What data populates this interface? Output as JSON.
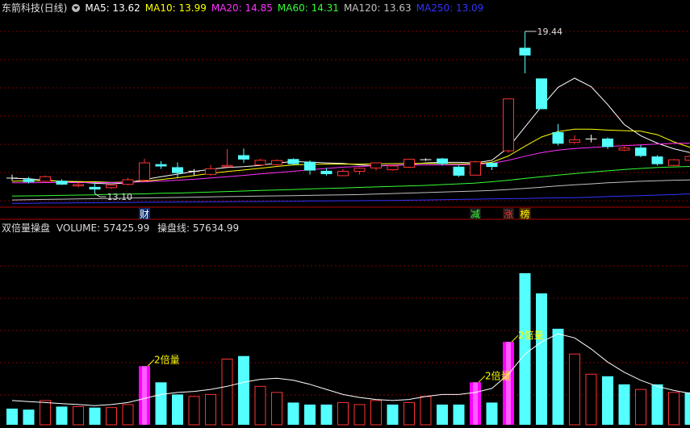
{
  "price_panel": {
    "stock_title": "东箭科技(日线)",
    "ma_items": [
      {
        "label": "MA5: 13.62",
        "color": "#ffffff"
      },
      {
        "label": "MA10: 13.99",
        "color": "#ffff00"
      },
      {
        "label": "MA20: 14.85",
        "color": "#ff33ff"
      },
      {
        "label": "MA60: 14.31",
        "color": "#33ff33"
      },
      {
        "label": "MA120: 13.63",
        "color": "#c0c0c0"
      },
      {
        "label": "MA250: 13.09",
        "color": "#3333ff"
      }
    ]
  },
  "volume_panel": {
    "indicator_name": "双倍量操盘",
    "volume_label": "VOLUME: 57425.99",
    "line_label": "操盘线: 57634.99"
  },
  "colors": {
    "up": "#ff3333",
    "down": "#54ffff",
    "double_volume": "#ff00ff",
    "grid": "#7a0000",
    "annotation": "#ffff00"
  },
  "chart_data": {
    "type": "candlestick",
    "ylim": [
      12.6,
      20.1
    ],
    "candles": [
      {
        "o": 13.72,
        "h": 13.84,
        "l": 13.6,
        "c": 13.72,
        "dir": "flat"
      },
      {
        "o": 13.66,
        "h": 13.75,
        "l": 13.5,
        "c": 13.55,
        "dir": "down"
      },
      {
        "o": 13.58,
        "h": 13.8,
        "l": 13.55,
        "c": 13.76,
        "dir": "up"
      },
      {
        "o": 13.6,
        "h": 13.66,
        "l": 13.44,
        "c": 13.45,
        "dir": "down"
      },
      {
        "o": 13.4,
        "h": 13.52,
        "l": 13.34,
        "c": 13.45,
        "dir": "up"
      },
      {
        "o": 13.36,
        "h": 13.52,
        "l": 13.1,
        "c": 13.26,
        "dir": "down"
      },
      {
        "o": 13.33,
        "h": 13.48,
        "l": 13.28,
        "c": 13.43,
        "dir": "up"
      },
      {
        "o": 13.46,
        "h": 13.72,
        "l": 13.42,
        "c": 13.64,
        "dir": "up"
      },
      {
        "o": 13.62,
        "h": 14.46,
        "l": 13.6,
        "c": 14.3,
        "dir": "up"
      },
      {
        "o": 14.25,
        "h": 14.37,
        "l": 14.06,
        "c": 14.16,
        "dir": "down"
      },
      {
        "o": 14.13,
        "h": 14.32,
        "l": 13.73,
        "c": 13.9,
        "dir": "down"
      },
      {
        "o": 13.96,
        "h": 14.06,
        "l": 13.8,
        "c": 13.99,
        "dir": "flat"
      },
      {
        "o": 13.85,
        "h": 14.22,
        "l": 13.8,
        "c": 14.07,
        "dir": "up"
      },
      {
        "o": 14.15,
        "h": 14.84,
        "l": 14.13,
        "c": 14.2,
        "dir": "up"
      },
      {
        "o": 14.6,
        "h": 14.86,
        "l": 14.3,
        "c": 14.43,
        "dir": "down"
      },
      {
        "o": 14.22,
        "h": 14.46,
        "l": 14.2,
        "c": 14.4,
        "dir": "up"
      },
      {
        "o": 14.23,
        "h": 14.44,
        "l": 14.19,
        "c": 14.39,
        "dir": "up"
      },
      {
        "o": 14.45,
        "h": 14.48,
        "l": 14.2,
        "c": 14.25,
        "dir": "down"
      },
      {
        "o": 14.34,
        "h": 14.4,
        "l": 13.84,
        "c": 14.0,
        "dir": "down"
      },
      {
        "o": 13.99,
        "h": 14.1,
        "l": 13.8,
        "c": 13.86,
        "dir": "down"
      },
      {
        "o": 13.8,
        "h": 14.05,
        "l": 13.78,
        "c": 13.97,
        "dir": "up"
      },
      {
        "o": 13.97,
        "h": 14.12,
        "l": 13.84,
        "c": 14.09,
        "dir": "up"
      },
      {
        "o": 14.1,
        "h": 14.3,
        "l": 14.0,
        "c": 14.3,
        "dir": "up"
      },
      {
        "o": 14.03,
        "h": 14.2,
        "l": 14.0,
        "c": 14.18,
        "dir": "up"
      },
      {
        "o": 14.13,
        "h": 14.46,
        "l": 14.1,
        "c": 14.44,
        "dir": "up"
      },
      {
        "o": 14.44,
        "h": 14.48,
        "l": 14.38,
        "c": 14.44,
        "dir": "flat"
      },
      {
        "o": 14.47,
        "h": 14.5,
        "l": 14.2,
        "c": 14.26,
        "dir": "down"
      },
      {
        "o": 14.15,
        "h": 14.2,
        "l": 13.75,
        "c": 13.8,
        "dir": "down"
      },
      {
        "o": 13.82,
        "h": 14.38,
        "l": 13.82,
        "c": 14.34,
        "dir": "up"
      },
      {
        "o": 14.3,
        "h": 14.35,
        "l": 14.02,
        "c": 14.14,
        "dir": "down"
      },
      {
        "o": 14.77,
        "h": 16.8,
        "l": 14.7,
        "c": 16.8,
        "dir": "up"
      },
      {
        "o": 18.8,
        "h": 19.44,
        "l": 17.8,
        "c": 18.5,
        "dir": "down"
      },
      {
        "o": 17.6,
        "h": 17.6,
        "l": 16.4,
        "c": 16.4,
        "dir": "down"
      },
      {
        "o": 15.5,
        "h": 15.82,
        "l": 14.98,
        "c": 15.05,
        "dir": "down"
      },
      {
        "o": 15.1,
        "h": 15.38,
        "l": 15.05,
        "c": 15.2,
        "dir": "up"
      },
      {
        "o": 15.25,
        "h": 15.4,
        "l": 15.1,
        "c": 15.25,
        "dir": "flat"
      },
      {
        "o": 15.25,
        "h": 15.3,
        "l": 14.84,
        "c": 14.92,
        "dir": "down"
      },
      {
        "o": 14.8,
        "h": 14.96,
        "l": 14.76,
        "c": 14.88,
        "dir": "up"
      },
      {
        "o": 14.9,
        "h": 15.0,
        "l": 14.52,
        "c": 14.57,
        "dir": "down"
      },
      {
        "o": 14.55,
        "h": 14.6,
        "l": 14.2,
        "c": 14.25,
        "dir": "down"
      },
      {
        "o": 14.2,
        "h": 14.45,
        "l": 14.18,
        "c": 14.42,
        "dir": "up"
      },
      {
        "o": 14.4,
        "h": 14.58,
        "l": 14.36,
        "c": 14.55,
        "dir": "up"
      }
    ],
    "ma_lines": {
      "ma5": [
        13.7,
        13.68,
        13.62,
        13.58,
        13.55,
        13.5,
        13.48,
        13.52,
        13.65,
        13.76,
        13.86,
        13.96,
        14.05,
        14.12,
        14.15,
        14.2,
        14.3,
        14.35,
        14.33,
        14.3,
        14.28,
        14.22,
        14.18,
        14.2,
        14.24,
        14.3,
        14.32,
        14.32,
        14.3,
        14.4,
        14.9,
        15.7,
        16.5,
        17.25,
        17.61,
        17.28,
        16.58,
        15.8,
        15.36,
        15.07,
        14.85,
        14.7
      ],
      "ma10": [
        13.58,
        13.6,
        13.6,
        13.58,
        13.57,
        13.56,
        13.54,
        13.55,
        13.58,
        13.65,
        13.72,
        13.8,
        13.89,
        13.96,
        14.02,
        14.09,
        14.16,
        14.22,
        14.24,
        14.25,
        14.25,
        14.25,
        14.26,
        14.27,
        14.28,
        14.28,
        14.27,
        14.26,
        14.26,
        14.32,
        14.57,
        14.95,
        15.31,
        15.52,
        15.62,
        15.62,
        15.58,
        15.56,
        15.54,
        15.4,
        15.12,
        14.9
      ],
      "ma20": [
        13.52,
        13.52,
        13.53,
        13.53,
        13.53,
        13.53,
        13.53,
        13.54,
        13.56,
        13.59,
        13.62,
        13.66,
        13.71,
        13.76,
        13.81,
        13.87,
        13.92,
        13.97,
        14.03,
        14.08,
        14.13,
        14.16,
        14.19,
        14.21,
        14.22,
        14.22,
        14.22,
        14.22,
        14.24,
        14.28,
        14.4,
        14.56,
        14.7,
        14.8,
        14.86,
        14.9,
        14.94,
        14.97,
        15.0,
        15.04,
        15.06,
        15.07
      ],
      "ma60": [
        13.0,
        13.01,
        13.02,
        13.03,
        13.04,
        13.05,
        13.07,
        13.08,
        13.09,
        13.11,
        13.12,
        13.14,
        13.16,
        13.18,
        13.2,
        13.22,
        13.24,
        13.26,
        13.28,
        13.3,
        13.32,
        13.34,
        13.36,
        13.38,
        13.4,
        13.42,
        13.45,
        13.48,
        13.51,
        13.56,
        13.62,
        13.69,
        13.76,
        13.82,
        13.88,
        13.94,
        13.99,
        14.04,
        14.08,
        14.12,
        14.14,
        14.16
      ],
      "ma120": [
        12.85,
        12.86,
        12.87,
        12.88,
        12.89,
        12.9,
        12.91,
        12.92,
        12.93,
        12.94,
        12.95,
        12.96,
        12.97,
        12.98,
        12.99,
        13.0,
        13.01,
        13.02,
        13.03,
        13.04,
        13.05,
        13.06,
        13.08,
        13.1,
        13.12,
        13.14,
        13.16,
        13.18,
        13.2,
        13.22,
        13.26,
        13.3,
        13.35,
        13.4,
        13.44,
        13.48,
        13.52,
        13.55,
        13.58,
        13.6,
        13.62,
        13.63
      ],
      "ma250": [
        12.72,
        12.72,
        12.73,
        12.73,
        12.74,
        12.74,
        12.75,
        12.75,
        12.76,
        12.76,
        12.77,
        12.77,
        12.78,
        12.78,
        12.79,
        12.79,
        12.8,
        12.8,
        12.81,
        12.81,
        12.82,
        12.82,
        12.83,
        12.83,
        12.84,
        12.85,
        12.86,
        12.87,
        12.88,
        12.89,
        12.9,
        12.91,
        12.92,
        12.93,
        12.94,
        12.96,
        12.98,
        13.0,
        13.02,
        13.04,
        13.06,
        13.09
      ]
    },
    "price_annotations": [
      {
        "index": 5,
        "price": 13.1,
        "label": "13.10",
        "kind": "low"
      },
      {
        "index": 31,
        "price": 19.44,
        "label": "19.44",
        "kind": "high"
      }
    ],
    "event_markers": [
      {
        "index": 8,
        "label": "财",
        "text_color": "#ffffff",
        "bg": "#0a2a6a"
      },
      {
        "index": 28,
        "label": "减",
        "text_color": "#33ff33",
        "bg": "#1a1a1a"
      },
      {
        "index": 30,
        "label": "涨",
        "text_color": "#ff3333",
        "bg": "#1a1a1a"
      },
      {
        "index": 31,
        "label": "榜",
        "text_color": "#ffff00",
        "bg": "#4a2a00"
      }
    ],
    "volume": {
      "ylim": [
        0,
        185000
      ],
      "values": [
        16000,
        15000,
        24000,
        18000,
        18000,
        17000,
        17000,
        20000,
        58000,
        42000,
        30000,
        28000,
        30000,
        65000,
        68000,
        38000,
        32000,
        22000,
        20000,
        20000,
        22000,
        20000,
        24000,
        20000,
        22000,
        28000,
        20000,
        20000,
        42000,
        22000,
        82000,
        150000,
        130000,
        95000,
        70000,
        50000,
        48000,
        40000,
        35000,
        40000,
        32000,
        32000
      ],
      "bar_type": [
        "down",
        "down",
        "up",
        "down",
        "up",
        "down",
        "up",
        "up",
        "double",
        "down",
        "down",
        "up",
        "up",
        "up",
        "down",
        "up",
        "up",
        "down",
        "down",
        "down",
        "up",
        "up",
        "up",
        "down",
        "up",
        "up",
        "down",
        "down",
        "double",
        "down",
        "double",
        "down",
        "down",
        "down",
        "up",
        "up",
        "down",
        "down",
        "up",
        "down",
        "up",
        "down"
      ],
      "line": [
        24000,
        23000,
        22000,
        21000,
        20000,
        19000,
        20000,
        22000,
        26000,
        30000,
        32000,
        33000,
        35000,
        38000,
        42000,
        45000,
        46000,
        44000,
        40000,
        35000,
        30000,
        27000,
        25000,
        24000,
        25000,
        28000,
        30000,
        30000,
        32000,
        36000,
        50000,
        70000,
        82000,
        90000,
        86000,
        75000,
        62000,
        52000,
        44000,
        38000,
        34000,
        31000
      ],
      "annotations": [
        {
          "index": 8,
          "label": "2倍量"
        },
        {
          "index": 28,
          "label": "2倍量"
        },
        {
          "index": 30,
          "label": "2倍量"
        }
      ]
    }
  }
}
